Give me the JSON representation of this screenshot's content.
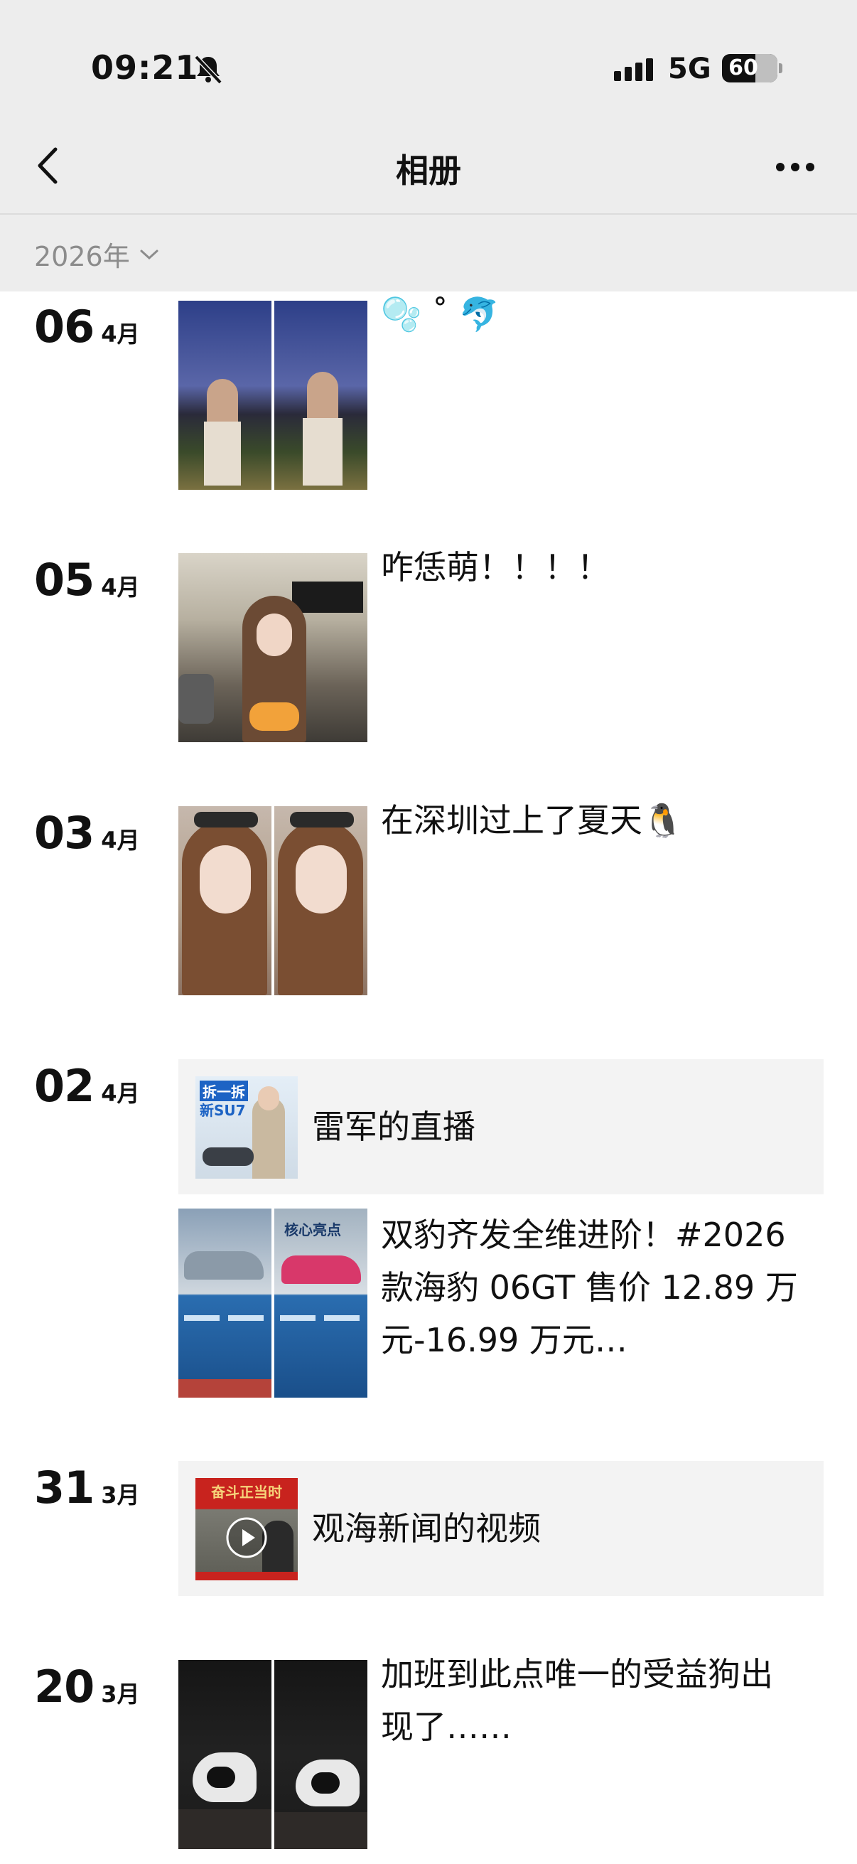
{
  "status": {
    "time": "09:21",
    "network": "5G",
    "battery": "60",
    "battery_level": 0.6
  },
  "header": {
    "title": "相册"
  },
  "filter": {
    "year_label": "2026年"
  },
  "feed": [
    {
      "day": "06",
      "month": "4月",
      "caption": "🫧 ˚ 🐬"
    },
    {
      "day": "05",
      "month": "4月",
      "caption": "咋恁萌！！！！"
    },
    {
      "day": "03",
      "month": "4月",
      "caption": "在深圳过上了夏天🐧"
    },
    {
      "day": "02",
      "month": "4月",
      "shared": {
        "title": "雷军的直播",
        "thumb_text_1": "拆一拆",
        "thumb_text_2": "新SU7"
      },
      "post": {
        "caption": "双豹齐发全维进阶！#2026 款海豹 06GT 售价 12.89 万元-16.99 万元…",
        "thumb_text": "核心亮点"
      }
    },
    {
      "day": "31",
      "month": "3月",
      "shared": {
        "title": "观海新闻的视频",
        "thumb_text": "奋斗正当时"
      }
    },
    {
      "day": "20",
      "month": "3月",
      "caption": "加班到此点唯一的受益狗出现了……"
    }
  ]
}
